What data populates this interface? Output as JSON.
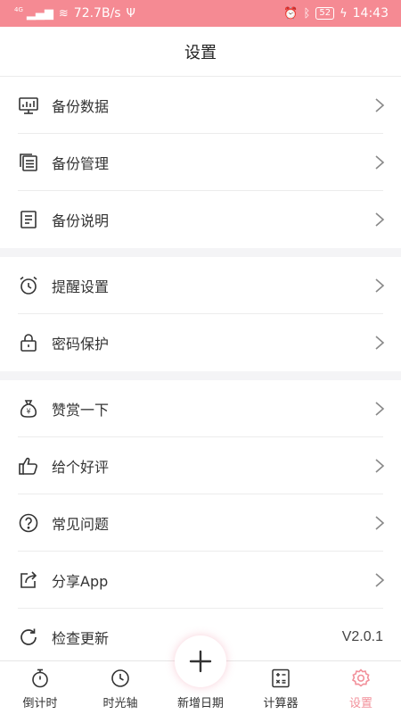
{
  "status_bar": {
    "network": "4G",
    "speed": "72.7B/s",
    "battery": "52",
    "time": "14:43"
  },
  "header": {
    "title": "设置"
  },
  "sections": [
    {
      "items": [
        {
          "label": "备份数据",
          "icon": "monitor-chart-icon"
        },
        {
          "label": "备份管理",
          "icon": "copy-docs-icon"
        },
        {
          "label": "备份说明",
          "icon": "document-icon"
        }
      ]
    },
    {
      "items": [
        {
          "label": "提醒设置",
          "icon": "alarm-clock-icon"
        },
        {
          "label": "密码保护",
          "icon": "lock-icon"
        }
      ]
    },
    {
      "items": [
        {
          "label": "赞赏一下",
          "icon": "money-bag-icon"
        },
        {
          "label": "给个好评",
          "icon": "thumbs-up-icon"
        },
        {
          "label": "常见问题",
          "icon": "question-icon"
        },
        {
          "label": "分享App",
          "icon": "share-icon"
        },
        {
          "label": "检查更新",
          "icon": "refresh-icon",
          "value": "V2.0.1"
        }
      ]
    }
  ],
  "tabs": [
    {
      "label": "倒计时",
      "icon": "stopwatch-icon"
    },
    {
      "label": "时光轴",
      "icon": "clock-icon"
    },
    {
      "label": "新增日期",
      "icon": "plus-icon"
    },
    {
      "label": "计算器",
      "icon": "calculator-icon"
    },
    {
      "label": "设置",
      "icon": "gear-icon",
      "active": true
    }
  ],
  "colors": {
    "accent": "#f2909a",
    "status_bar": "#f58a93",
    "section_gap": "#f4f4f6"
  }
}
